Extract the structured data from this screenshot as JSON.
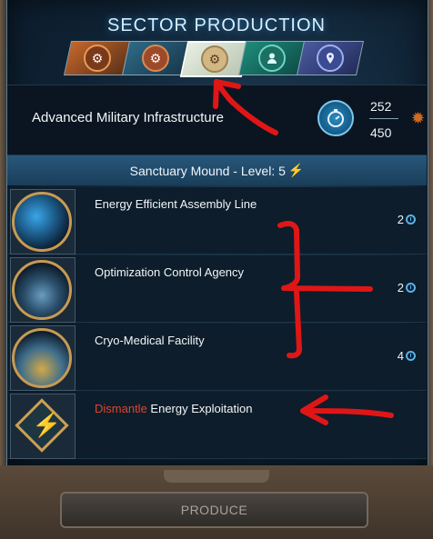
{
  "title": "SECTOR PRODUCTION",
  "tabs": [
    {
      "icon": "gear-icon",
      "selected": false
    },
    {
      "icon": "gear-icon",
      "selected": false
    },
    {
      "icon": "cog-pin-icon",
      "selected": true
    },
    {
      "icon": "person-icon",
      "selected": false
    },
    {
      "icon": "location-pin-icon",
      "selected": false
    }
  ],
  "header": {
    "name": "Advanced Military Infrastructure",
    "production_current": "252",
    "production_max": "450"
  },
  "level_bar": {
    "label": "Sanctuary Mound - Level: 5"
  },
  "items": [
    {
      "name": "Energy Efficient Assembly Line",
      "cost": "2"
    },
    {
      "name": "Optimization Control Agency",
      "cost": "2"
    },
    {
      "name": "Cryo-Medical Facility",
      "cost": "4"
    },
    {
      "prefix": "Dismantle",
      "name": "Energy Exploitation"
    }
  ],
  "produce_button": "PRODUCE",
  "colors": {
    "accent_blue": "#2a8cc2",
    "dismantle_red": "#e0452c",
    "bolt_yellow": "#f4c21c",
    "annotation_red": "#e01616"
  }
}
